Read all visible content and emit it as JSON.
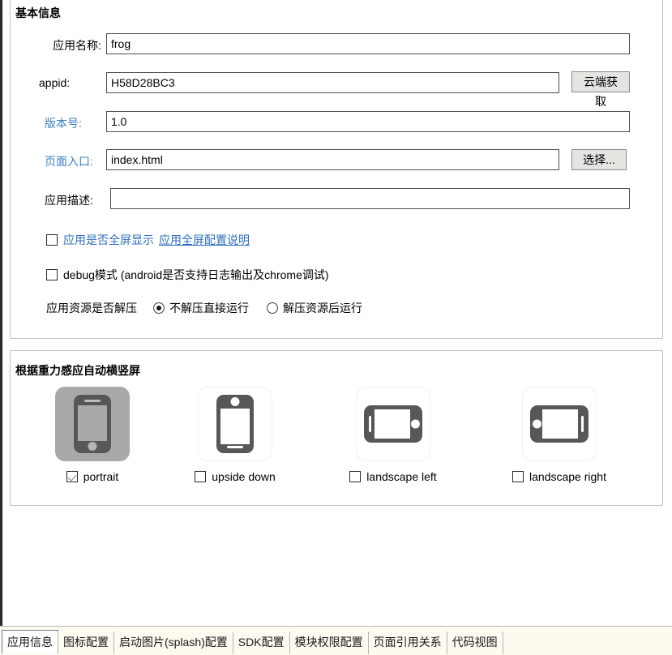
{
  "window": {
    "accent_blue": "#3b7fc4",
    "link_blue": "#2f6fbd",
    "tabbar_bg": "#fdfaf0",
    "selected_tile_bg": "#a9a9a9",
    "phone_glyph_color": "#575757"
  },
  "basic_group": {
    "title": "基本信息",
    "fields": [
      {
        "label": "应用名称:",
        "value": "frog",
        "placeholder": ""
      },
      {
        "label": "appid:",
        "value": "H58D28BC3",
        "placeholder": ""
      },
      {
        "label": "版本号:",
        "value": "1.0",
        "placeholder": ""
      },
      {
        "label": "页面入口:",
        "value": "index.html",
        "placeholder": ""
      },
      {
        "label": "应用描述:",
        "value": "",
        "placeholder": ""
      }
    ],
    "buttons": {
      "cloud_fetch": "云端获取",
      "choose": "选择..."
    },
    "fullscreen_row": {
      "checked": false,
      "label": "应用是否全屏显示",
      "link": "应用全屏配置说明"
    },
    "debug_row": {
      "checked": false,
      "label": "debug模式 (android是否支持日志输出及chrome调试)"
    },
    "resource_row": {
      "label": "应用资源是否解压",
      "options": [
        {
          "label": "不解压直接运行",
          "selected": true
        },
        {
          "label": "解压资源后运行",
          "selected": false
        }
      ]
    }
  },
  "orientation_group": {
    "title": "根据重力感应自动横竖屏",
    "items": [
      {
        "icon": "phone-portrait-icon",
        "label": "portrait",
        "checked": true,
        "selected": true
      },
      {
        "icon": "phone-upside-down-icon",
        "label": "upside down",
        "checked": false,
        "selected": false
      },
      {
        "icon": "phone-landscape-left-icon",
        "label": "landscape left",
        "checked": false,
        "selected": false
      },
      {
        "icon": "phone-landscape-right-icon",
        "label": "landscape right",
        "checked": false,
        "selected": false
      }
    ]
  },
  "tabs": [
    {
      "label": "应用信息",
      "active": true
    },
    {
      "label": "图标配置",
      "active": false
    },
    {
      "label": "启动图片(splash)配置",
      "active": false
    },
    {
      "label": "SDK配置",
      "active": false
    },
    {
      "label": "模块权限配置",
      "active": false
    },
    {
      "label": "页面引用关系",
      "active": false
    },
    {
      "label": "代码视图",
      "active": false
    }
  ]
}
